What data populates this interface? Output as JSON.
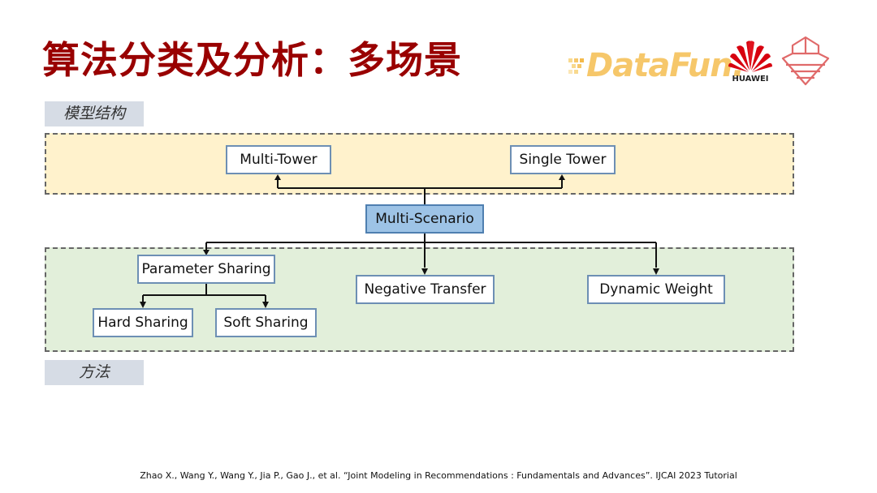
{
  "title": "算法分类及分析：多场景",
  "logos": {
    "datafun": "DataFun.",
    "huawei": "HUAWEI",
    "ship_icon": "ship-bow-icon"
  },
  "sections": {
    "model_structure": "模型结构",
    "methods": "方法"
  },
  "diagram": {
    "root": "Multi-Scenario",
    "model_structure_nodes": [
      "Multi-Tower",
      "Single Tower"
    ],
    "method_nodes": [
      "Parameter Sharing",
      "Negative Transfer",
      "Dynamic Weight"
    ],
    "parameter_sharing_children": [
      "Hard Sharing",
      "Soft Sharing"
    ]
  },
  "colors": {
    "title": "#990000",
    "root_fill": "#9dc3e6",
    "model_band": "#fff2cc",
    "method_band": "#e2efda",
    "label_bg": "#d6dce5"
  },
  "citation": "Zhao X., Wang Y., Wang Y., Jia P., Gao J., et al. “Joint Modeling in Recommendations : Fundamentals and Advances”. IJCAI 2023 Tutorial"
}
